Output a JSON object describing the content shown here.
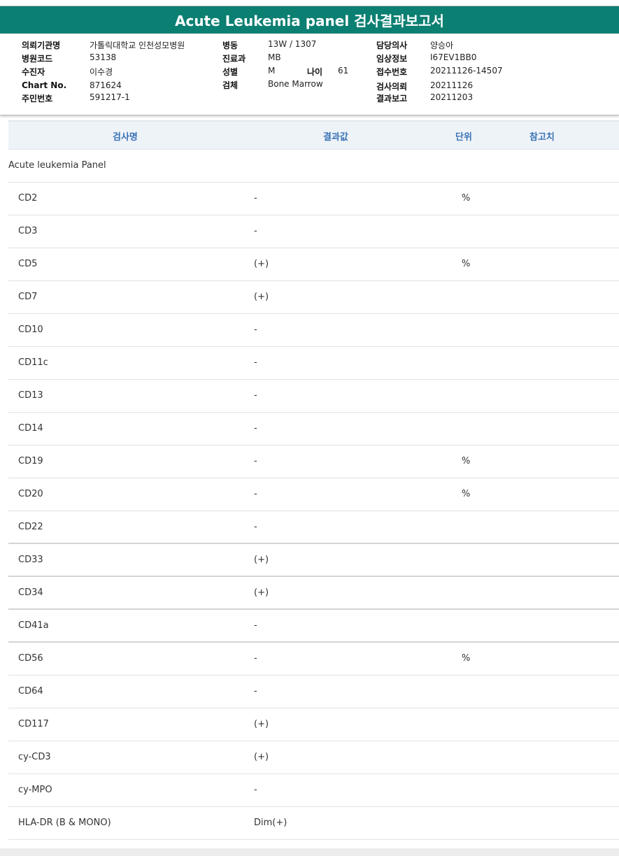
{
  "title": "Acute Leukemia panel 검사결과보고서",
  "info": {
    "col1": [
      {
        "label": "의뢰기관명",
        "value": "가톨릭대학교 인천성모병원"
      },
      {
        "label": "병원코드",
        "value": "53138"
      },
      {
        "label": "수진자",
        "value": "이수경"
      },
      {
        "label": "Chart No.",
        "value": "871624"
      },
      {
        "label": "주민번호",
        "value": "591217-1"
      }
    ],
    "col2": [
      {
        "label": "병동",
        "value": "13W / 1307"
      },
      {
        "label": "진료과",
        "value": "MB"
      },
      {
        "label": "성별",
        "value": "M"
      },
      {
        "label": "검체",
        "value": "Bone Marrow"
      }
    ],
    "age": {
      "label": "나이",
      "value": "61"
    },
    "col3": [
      {
        "label": "담당의사",
        "value": "양승아"
      },
      {
        "label": "임상정보",
        "value": "I67EV1BB0"
      },
      {
        "label": "접수번호",
        "value": "20211126-14507"
      },
      {
        "label": "검사의뢰",
        "value": "20211126"
      },
      {
        "label": "결과보고",
        "value": "20211203"
      }
    ]
  },
  "table": {
    "headers": {
      "name": "검사명",
      "value": "결과값",
      "unit": "단위",
      "ref": "참고치"
    },
    "section": "Acute leukemia Panel",
    "rows": [
      {
        "name": "CD2",
        "value": "-",
        "unit": "%"
      },
      {
        "name": "CD3",
        "value": "-",
        "unit": ""
      },
      {
        "name": "CD5",
        "value": "(+)",
        "unit": "%"
      },
      {
        "name": "CD7",
        "value": "(+)",
        "unit": ""
      },
      {
        "name": "CD10",
        "value": "-",
        "unit": ""
      },
      {
        "name": "CD11c",
        "value": "-",
        "unit": ""
      },
      {
        "name": "CD13",
        "value": "-",
        "unit": ""
      },
      {
        "name": "CD14",
        "value": "-",
        "unit": ""
      },
      {
        "name": "CD19",
        "value": "-",
        "unit": "%"
      },
      {
        "name": "CD20",
        "value": "-",
        "unit": "%"
      },
      {
        "name": "CD22",
        "value": "-",
        "unit": ""
      },
      {
        "name": "CD33",
        "value": "(+)",
        "unit": ""
      },
      {
        "name": "CD34",
        "value": "(+)",
        "unit": ""
      },
      {
        "name": "CD41a",
        "value": "-",
        "unit": ""
      },
      {
        "name": "CD56",
        "value": "-",
        "unit": "%"
      },
      {
        "name": "CD64",
        "value": "-",
        "unit": ""
      },
      {
        "name": "CD117",
        "value": "(+)",
        "unit": ""
      },
      {
        "name": "cy-CD3",
        "value": "(+)",
        "unit": ""
      },
      {
        "name": "cy-MPO",
        "value": "-",
        "unit": ""
      },
      {
        "name": "HLA-DR (B & MONO)",
        "value": "Dim(+)",
        "unit": ""
      }
    ]
  }
}
